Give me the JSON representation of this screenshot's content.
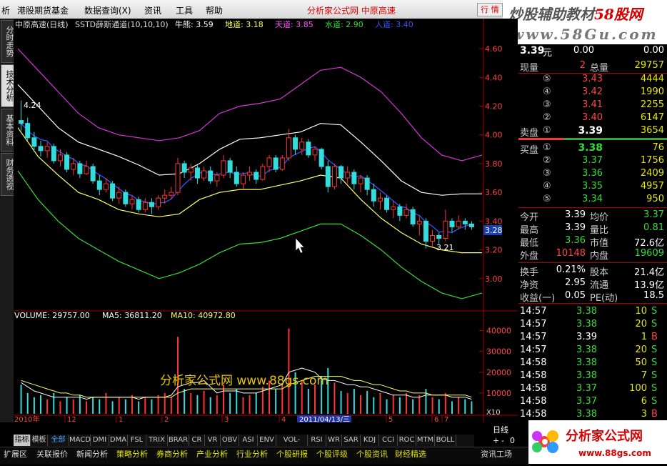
{
  "menu": {
    "items": [
      "析",
      "港股期货基金",
      "数据查询(X)",
      "资讯",
      "工具",
      "帮助"
    ],
    "center_title": "分析家公式网 中原高速",
    "quote_btn": "行 情"
  },
  "watermark": {
    "line1_a": "炒股辅助教材",
    "line1_b": "58股网",
    "line2": "www.58Gu.com"
  },
  "left_tabs": [
    "分时走势",
    "技术分析",
    "基本资料",
    "财务透视"
  ],
  "chart_header": {
    "stock": "中原高速(日线)",
    "indicator": "SSTD薛斯通道(10,10,10)",
    "items": [
      {
        "label": "牛熊: 3.59",
        "color": "#ffffff"
      },
      {
        "label": "地道: 3.18",
        "color": "#ffff66"
      },
      {
        "label": "天道: 3.85",
        "color": "#ff55ff"
      },
      {
        "label": "水道: 2.90",
        "color": "#33dd33"
      },
      {
        "label": "人道: 3.40",
        "color": "#3355ff"
      }
    ]
  },
  "volume_header": {
    "items": [
      {
        "label": "VOLUME: 29757.00",
        "color": "#ffffff"
      },
      {
        "label": "MA5: 36811.20",
        "color": "#ffffff"
      },
      {
        "label": "MA10: 40972.80",
        "color": "#ffff66"
      }
    ]
  },
  "chart_annotations": {
    "high": "4.24",
    "low": "3.21",
    "current_price_tag": "3.28",
    "date_tag": "2011/04/13/三",
    "watermark_text": "分析家公式网  www.88gs.com",
    "x10": "X10"
  },
  "chart_data": {
    "type": "candlestick",
    "price_axis": {
      "ticks": [
        "4.60",
        "4.40",
        "4.20",
        "4.00",
        "3.80",
        "3.60",
        "3.40",
        "3.20",
        "3.00"
      ],
      "range": [
        2.8,
        4.7
      ]
    },
    "volume_axis": {
      "ticks": [
        "40000",
        "30000",
        "20000",
        "10000"
      ],
      "range": [
        0,
        45000
      ]
    },
    "x_labels": [
      "2010年",
      "12",
      "1",
      "2",
      "3",
      "4",
      "5",
      "6",
      "7"
    ],
    "channels": {
      "tiandao": [
        4.6,
        4.45,
        4.3,
        4.15,
        4.05,
        4.0,
        3.98,
        3.96,
        3.98,
        4.03,
        4.15,
        4.2,
        4.22,
        4.25,
        4.35,
        4.45,
        4.47,
        4.4,
        4.3,
        4.15,
        3.98,
        3.86,
        3.82,
        3.86
      ],
      "niuxiong": [
        4.35,
        4.2,
        4.05,
        3.95,
        3.9,
        3.85,
        3.79,
        3.72,
        3.73,
        3.8,
        3.9,
        3.97,
        3.98,
        4.0,
        4.02,
        4.08,
        4.07,
        3.95,
        3.82,
        3.68,
        3.6,
        3.58,
        3.59,
        3.59
      ],
      "didao": [
        4.05,
        3.85,
        3.72,
        3.6,
        3.55,
        3.48,
        3.45,
        3.43,
        3.45,
        3.55,
        3.6,
        3.62,
        3.62,
        3.65,
        3.68,
        3.72,
        3.7,
        3.55,
        3.42,
        3.32,
        3.24,
        3.2,
        3.18,
        3.18
      ],
      "shuidao": [
        3.75,
        3.55,
        3.4,
        3.28,
        3.2,
        3.12,
        3.06,
        3.0,
        3.04,
        3.1,
        3.18,
        3.24,
        3.25,
        3.28,
        3.33,
        3.38,
        3.38,
        3.3,
        3.2,
        3.08,
        2.98,
        2.9,
        2.86,
        2.9
      ]
    },
    "candles": [
      [
        4.1,
        4.24,
        4.03,
        4.08
      ],
      [
        4.08,
        4.12,
        3.96,
        3.98
      ],
      [
        3.98,
        4.02,
        3.88,
        3.92
      ],
      [
        3.92,
        3.96,
        3.85,
        3.89
      ],
      [
        3.89,
        3.95,
        3.84,
        3.92
      ],
      [
        3.92,
        3.94,
        3.8,
        3.82
      ],
      [
        3.82,
        3.9,
        3.78,
        3.86
      ],
      [
        3.86,
        3.88,
        3.74,
        3.76
      ],
      [
        3.76,
        3.84,
        3.72,
        3.8
      ],
      [
        3.8,
        3.82,
        3.7,
        3.73
      ],
      [
        3.73,
        3.82,
        3.72,
        3.78
      ],
      [
        3.78,
        3.8,
        3.66,
        3.68
      ],
      [
        3.68,
        3.72,
        3.58,
        3.62
      ],
      [
        3.62,
        3.7,
        3.6,
        3.66
      ],
      [
        3.66,
        3.68,
        3.54,
        3.56
      ],
      [
        3.56,
        3.64,
        3.52,
        3.6
      ],
      [
        3.6,
        3.62,
        3.5,
        3.52
      ],
      [
        3.52,
        3.58,
        3.48,
        3.55
      ],
      [
        3.55,
        3.57,
        3.46,
        3.48
      ],
      [
        3.48,
        3.56,
        3.46,
        3.53
      ],
      [
        3.53,
        3.56,
        3.45,
        3.5
      ],
      [
        3.5,
        3.58,
        3.48,
        3.56
      ],
      [
        3.56,
        3.62,
        3.52,
        3.58
      ],
      [
        3.58,
        3.64,
        3.55,
        3.6
      ],
      [
        3.6,
        3.84,
        3.58,
        3.8
      ],
      [
        3.8,
        3.82,
        3.7,
        3.74
      ],
      [
        3.74,
        3.8,
        3.68,
        3.77
      ],
      [
        3.77,
        3.79,
        3.66,
        3.7
      ],
      [
        3.7,
        3.78,
        3.68,
        3.75
      ],
      [
        3.75,
        3.78,
        3.66,
        3.68
      ],
      [
        3.68,
        3.74,
        3.64,
        3.72
      ],
      [
        3.72,
        3.86,
        3.7,
        3.82
      ],
      [
        3.82,
        3.84,
        3.7,
        3.74
      ],
      [
        3.74,
        3.78,
        3.64,
        3.66
      ],
      [
        3.66,
        3.74,
        3.62,
        3.72
      ],
      [
        3.72,
        3.78,
        3.68,
        3.74
      ],
      [
        3.74,
        3.76,
        3.66,
        3.69
      ],
      [
        3.69,
        3.8,
        3.68,
        3.78
      ],
      [
        3.78,
        3.86,
        3.74,
        3.84
      ],
      [
        3.84,
        3.86,
        3.74,
        3.76
      ],
      [
        3.76,
        3.86,
        3.75,
        3.84
      ],
      [
        3.84,
        4.04,
        3.82,
        3.98
      ],
      [
        3.98,
        4.0,
        3.86,
        3.9
      ],
      [
        3.9,
        3.98,
        3.86,
        3.95
      ],
      [
        3.95,
        3.97,
        3.84,
        3.86
      ],
      [
        3.86,
        3.92,
        3.82,
        3.9
      ],
      [
        3.9,
        3.91,
        3.76,
        3.78
      ],
      [
        3.78,
        3.82,
        3.6,
        3.64
      ],
      [
        3.64,
        3.8,
        3.62,
        3.78
      ],
      [
        3.78,
        3.79,
        3.66,
        3.7
      ],
      [
        3.7,
        3.78,
        3.66,
        3.74
      ],
      [
        3.74,
        3.76,
        3.62,
        3.66
      ],
      [
        3.66,
        3.72,
        3.6,
        3.7
      ],
      [
        3.7,
        3.72,
        3.58,
        3.62
      ],
      [
        3.62,
        3.66,
        3.5,
        3.54
      ],
      [
        3.54,
        3.6,
        3.48,
        3.56
      ],
      [
        3.56,
        3.58,
        3.46,
        3.48
      ],
      [
        3.48,
        3.54,
        3.42,
        3.5
      ],
      [
        3.5,
        3.52,
        3.4,
        3.44
      ],
      [
        3.44,
        3.52,
        3.42,
        3.48
      ],
      [
        3.48,
        3.5,
        3.36,
        3.38
      ],
      [
        3.38,
        3.44,
        3.3,
        3.4
      ],
      [
        3.4,
        3.42,
        3.21,
        3.26
      ],
      [
        3.26,
        3.34,
        3.22,
        3.3
      ],
      [
        3.3,
        3.32,
        3.24,
        3.28
      ],
      [
        3.28,
        3.48,
        3.26,
        3.4
      ],
      [
        3.4,
        3.42,
        3.32,
        3.36
      ],
      [
        3.36,
        3.44,
        3.34,
        3.4
      ],
      [
        3.4,
        3.42,
        3.34,
        3.38
      ],
      [
        3.38,
        3.4,
        3.34,
        3.36
      ]
    ],
    "volumes": [
      14,
      10,
      8,
      9,
      7,
      10,
      6,
      8,
      7,
      9,
      6,
      8,
      7,
      10,
      6,
      8,
      7,
      9,
      6,
      8,
      7,
      9,
      10,
      8,
      37,
      12,
      10,
      9,
      11,
      8,
      9,
      14,
      10,
      12,
      8,
      9,
      10,
      13,
      16,
      12,
      14,
      41,
      20,
      16,
      12,
      14,
      18,
      22,
      15,
      11,
      10,
      12,
      9,
      11,
      8,
      10,
      7,
      9,
      8,
      10,
      7,
      9,
      12,
      8,
      7,
      10,
      6,
      8,
      7,
      6
    ],
    "ma5": [
      15,
      13,
      11,
      10,
      9,
      8,
      8,
      8,
      8,
      8,
      7,
      8,
      8,
      8,
      8,
      8,
      8,
      8,
      7,
      8,
      8,
      8,
      8,
      9,
      13,
      14,
      15,
      15,
      16,
      13,
      10,
      11,
      11,
      11,
      10,
      10,
      10,
      11,
      12,
      13,
      14,
      20,
      21,
      22,
      21,
      20,
      17,
      16,
      16,
      15,
      14,
      14,
      13,
      13,
      12,
      11,
      10,
      9,
      9,
      9,
      8,
      8,
      9,
      9,
      9,
      9,
      8,
      8,
      8,
      7
    ],
    "ma10": [
      16,
      15,
      14,
      13,
      12,
      11,
      10,
      10,
      9,
      9,
      8,
      8,
      8,
      8,
      8,
      8,
      8,
      8,
      8,
      8,
      8,
      8,
      8,
      8,
      10,
      11,
      12,
      12,
      12,
      12,
      12,
      12,
      12,
      12,
      12,
      12,
      12,
      12,
      12,
      12,
      12,
      14,
      15,
      16,
      17,
      18,
      18,
      18,
      18,
      18,
      17,
      16,
      16,
      15,
      14,
      14,
      13,
      12,
      11,
      11,
      10,
      10,
      10,
      9,
      9,
      9,
      9,
      9,
      9,
      8
    ]
  },
  "quote": {
    "price": "3.39",
    "unit": "元",
    "change": "0.00",
    "change_pct": "0.00",
    "now_vol_label": "现量",
    "now_vol": "2",
    "total_vol_label": "总量",
    "total_vol": "29757",
    "sell": [
      {
        "idx": "⑤",
        "price": "3.43",
        "vol": "4444"
      },
      {
        "idx": "④",
        "price": "3.42",
        "vol": "1990"
      },
      {
        "idx": "③",
        "price": "3.41",
        "vol": "2255"
      },
      {
        "idx": "②",
        "price": "3.40",
        "vol": "6147"
      },
      {
        "idx": "①",
        "price": "3.39",
        "vol": "3654"
      }
    ],
    "sell_label": "卖盘",
    "buy_label": "买盘",
    "buy": [
      {
        "idx": "①",
        "price": "3.38",
        "vol": "76"
      },
      {
        "idx": "②",
        "price": "3.37",
        "vol": "1756"
      },
      {
        "idx": "③",
        "price": "3.36",
        "vol": "2409"
      },
      {
        "idx": "④",
        "price": "3.35",
        "vol": "4957"
      },
      {
        "idx": "⑤",
        "price": "3.34",
        "vol": "950"
      }
    ],
    "stats": [
      {
        "l1": "今开",
        "v1": "3.39",
        "c1": "#ffffff",
        "l2": "均价",
        "v2": "3.37",
        "c2": "#33dd33"
      },
      {
        "l1": "最高",
        "v1": "3.39",
        "c1": "#ffffff",
        "l2": "量比",
        "v2": "0.81",
        "c2": "#33dd33"
      },
      {
        "l1": "最低",
        "v1": "3.36",
        "c1": "#33dd33",
        "l2": "市值",
        "v2": "72.6亿",
        "c2": "#ffffff"
      },
      {
        "l1": "外盘",
        "v1": "10148",
        "c1": "#ff4444",
        "l2": "内盘",
        "v2": "19609",
        "c2": "#33dd33"
      }
    ],
    "fund": [
      {
        "l1": "换手",
        "v1": "0.21%",
        "l2": "股本",
        "v2": "21.4亿"
      },
      {
        "l1": "净资",
        "v1": "2.95",
        "l2": "流通",
        "v2": "13.9亿"
      },
      {
        "l1": "收益(一)",
        "v1": "0.05",
        "l2": "PE(动)",
        "v2": "18.5"
      }
    ],
    "ticks": [
      {
        "time": "14:57",
        "price": "3.38",
        "pc": "#33dd33",
        "vol": "10",
        "bs": "S"
      },
      {
        "time": "14:57",
        "price": "3.38",
        "pc": "#33dd33",
        "vol": "20",
        "bs": "S"
      },
      {
        "time": "14:57",
        "price": "3.39",
        "pc": "#ffffff",
        "vol": "1",
        "bs": "B"
      },
      {
        "time": "14:57",
        "price": "3.38",
        "pc": "#33dd33",
        "vol": "20",
        "bs": "S"
      },
      {
        "time": "14:58",
        "price": "3.38",
        "pc": "#33dd33",
        "vol": "50",
        "bs": "S"
      },
      {
        "time": "14:58",
        "price": "3.38",
        "pc": "#33dd33",
        "vol": "7",
        "bs": "S"
      },
      {
        "time": "14:58",
        "price": "3.37",
        "pc": "#33dd33",
        "vol": "100",
        "bs": "S"
      },
      {
        "time": "14:58",
        "price": "3.37",
        "pc": "#33dd33",
        "vol": "6",
        "bs": "S"
      },
      {
        "time": "14:58",
        "price": "3.38",
        "pc": "#33dd33",
        "vol": "3",
        "bs": "B"
      }
    ]
  },
  "bottom": {
    "period": "日线",
    "plus": "+",
    "minus": "-",
    "zero": "0",
    "index_tabs": [
      "指标",
      "模板",
      "全部",
      "MACD",
      "DMI",
      "DMA",
      "FSL",
      "TRIX",
      "BRAR",
      "CR",
      "VR",
      "OBV",
      "ASI",
      "ENV",
      "VOL-TDX",
      "RSI",
      "WR",
      "SAR",
      "KDJ",
      "CCI",
      "ROC",
      "MTM",
      "BOLL"
    ],
    "status_items": [
      "扩展区",
      "关联报价",
      "新闻分析",
      "策略分析",
      "券商分析",
      "产业分析",
      "行业分析",
      "个股研报",
      "个股评级",
      "个股资讯",
      "财经精选"
    ],
    "right_tab": "资讯工场"
  },
  "logo": {
    "title": "分析家公式网",
    "url": "www.88gs.com"
  }
}
